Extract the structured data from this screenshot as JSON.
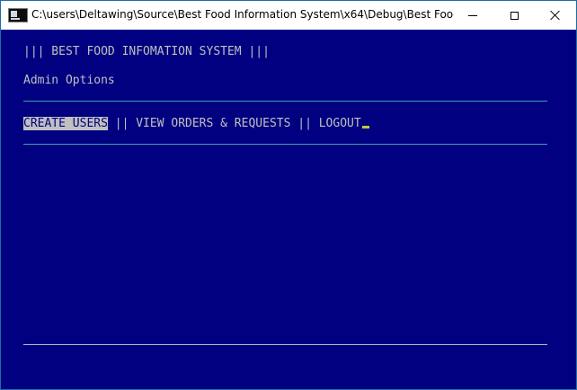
{
  "window": {
    "title": "C:\\users\\Deltawing\\Source\\Best Food Information System\\x64\\Debug\\Best Food Infor..."
  },
  "console": {
    "header": "||| BEST FOOD INFOMATION SYSTEM |||",
    "subheader": "Admin Options",
    "menu": {
      "items": [
        {
          "label": "CREATE USERS",
          "selected": true
        },
        {
          "label": "VIEW ORDERS & REQUESTS",
          "selected": false
        },
        {
          "label": "LOGOUT",
          "selected": false
        }
      ],
      "separator": " || "
    }
  },
  "colors": {
    "console_bg": "#000080",
    "console_text": "#c0c0c0",
    "rule": "#3aa0b8",
    "cursor": "#c8c832"
  },
  "icons": {
    "app": "console-app-icon",
    "minimize": "minimize-icon",
    "maximize": "maximize-icon",
    "close": "close-icon"
  }
}
